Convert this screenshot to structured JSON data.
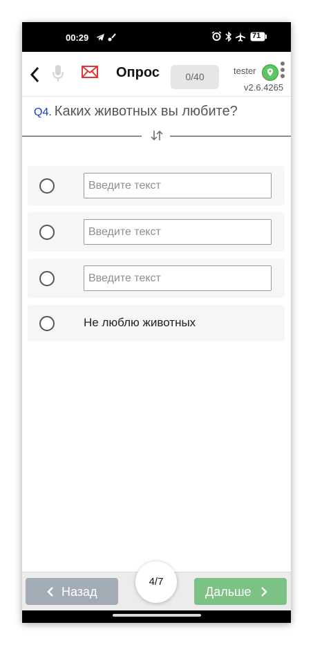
{
  "status_bar": {
    "time": "00:29",
    "battery": "71",
    "icons": [
      "telegram-icon",
      "notification-icon",
      "alarm-icon",
      "bluetooth-icon",
      "airplane-mode-icon",
      "battery-icon"
    ]
  },
  "header": {
    "title": "Опрос",
    "counter": "0/40",
    "user": "tester",
    "version": "v2.6.4265",
    "colors": {
      "mail": "#e03434",
      "location_badge": "#5fc463"
    }
  },
  "question": {
    "number": "Q4.",
    "text": "Каких животных вы любите?"
  },
  "options": [
    {
      "type": "input",
      "placeholder": "Введите текст",
      "value": ""
    },
    {
      "type": "input",
      "placeholder": "Введите текст",
      "value": ""
    },
    {
      "type": "input",
      "placeholder": "Введите текст",
      "value": ""
    },
    {
      "type": "label",
      "label": "Не люблю животных"
    }
  ],
  "footer": {
    "back_label": "Назад",
    "next_label": "Дальше",
    "page": "4/7",
    "colors": {
      "back": "#a3abb5",
      "next": "#7cc284"
    }
  }
}
